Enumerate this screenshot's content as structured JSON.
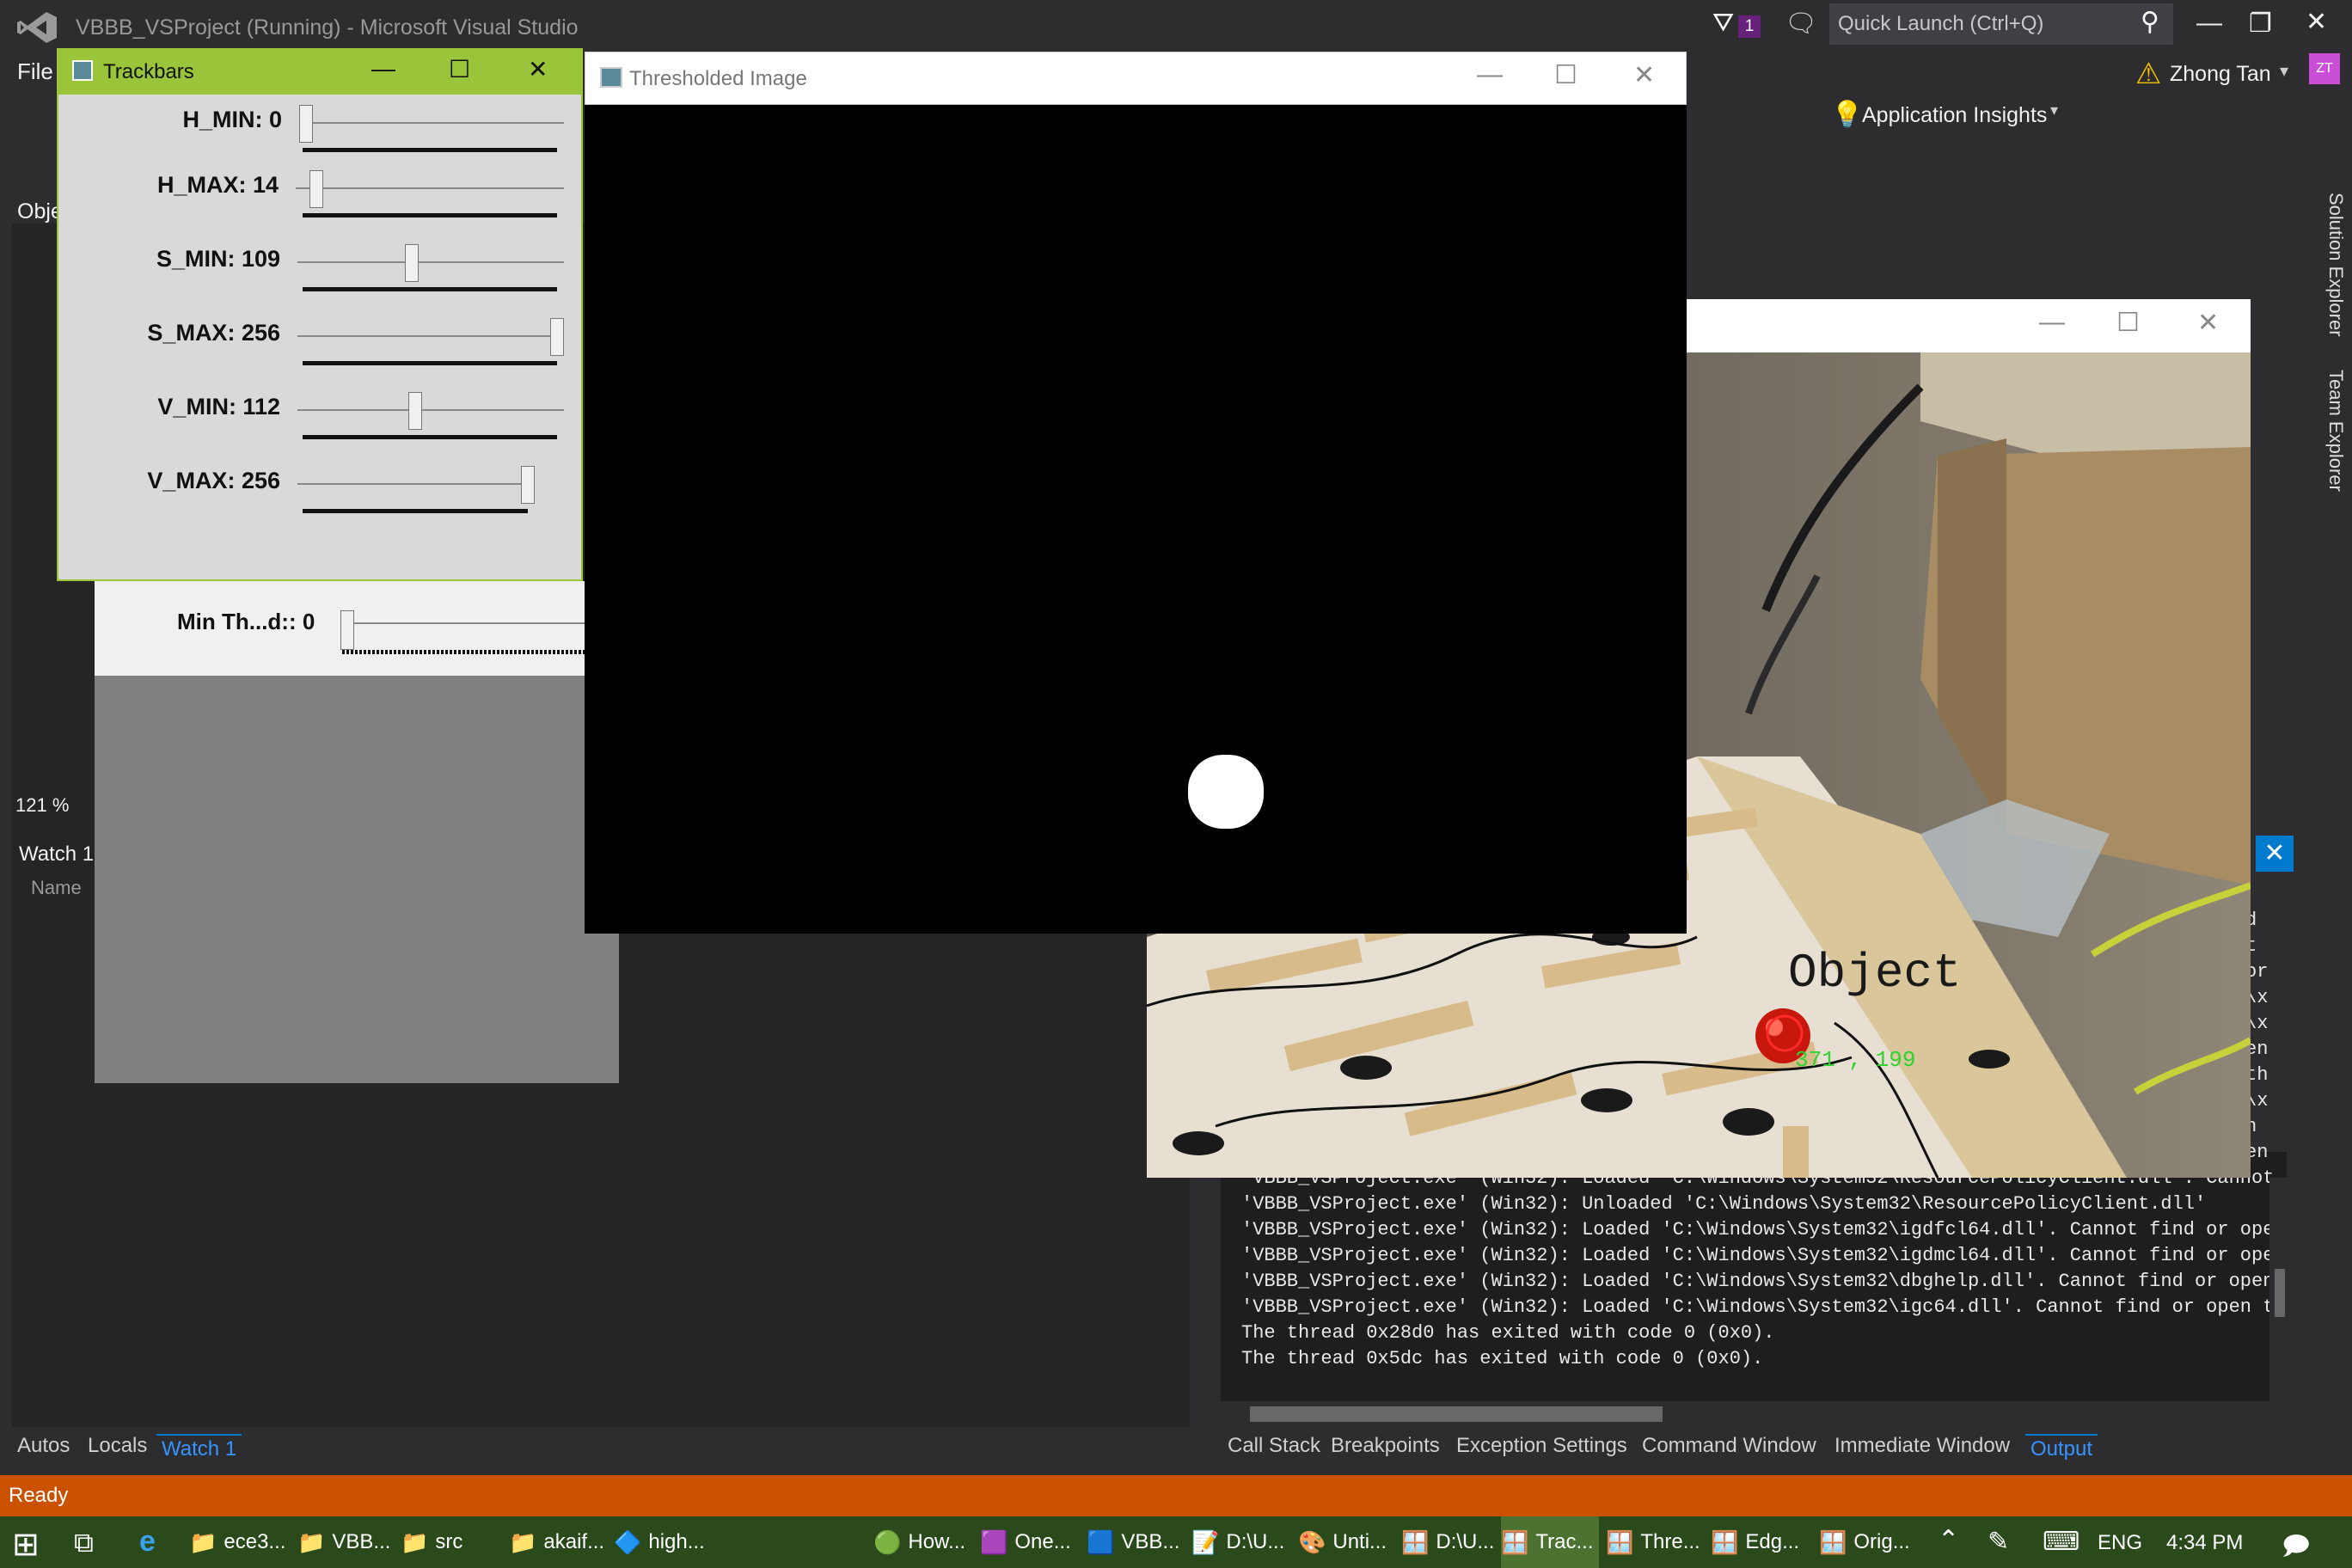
{
  "vs": {
    "title": "VBBB_VSProject (Running) - Microsoft Visual Studio",
    "menu_file": "File",
    "notif_count": "1",
    "quick_launch": "Quick Launch (Ctrl+Q)",
    "user_name": "Zhong Tan",
    "avatar": "ZT",
    "app_insights": "Application Insights",
    "obj_partial": "Obje",
    "zoom": "121 %",
    "watch_title": "Watch 1",
    "watch_name_col": "Name",
    "left_tabs": [
      "Autos",
      "Locals",
      "Watch 1"
    ],
    "right_tabs": [
      "Call Stack",
      "Breakpoints",
      "Exception Settings",
      "Command Window",
      "Immediate Window",
      "Output"
    ],
    "side_tabs": [
      "Solution Explorer",
      "Team Explorer"
    ],
    "status": "Ready",
    "accent_color": "#007acc",
    "status_color": "#ca5100"
  },
  "output": {
    "lines": [
      "'VBBB_VSProject.exe' (Win32): Loaded 'C:\\Windows\\System32\\ResourcePolicyClient.dll'. Cannot",
      "'VBBB_VSProject.exe' (Win32): Unloaded 'C:\\Windows\\System32\\ResourcePolicyClient.dll'",
      "'VBBB_VSProject.exe' (Win32): Loaded 'C:\\Windows\\System32\\igdfcl64.dll'. Cannot find or open",
      "'VBBB_VSProject.exe' (Win32): Loaded 'C:\\Windows\\System32\\igdmcl64.dll'. Cannot find or open",
      "'VBBB_VSProject.exe' (Win32): Loaded 'C:\\Windows\\System32\\dbghelp.dll'. Cannot find or open",
      "'VBBB_VSProject.exe' (Win32): Loaded 'C:\\Windows\\System32\\igc64.dll'. Cannot find or open th",
      "The thread 0x28d0 has exited with code 0 (0x0).",
      "The thread 0x5dc has exited with code 0 (0x0)."
    ],
    "cut_right": [
      "d",
      "t",
      "or",
      "\\x",
      "\\x",
      "en",
      "th",
      "\\x",
      "n",
      "en"
    ]
  },
  "trackbars": {
    "title": "Trackbars",
    "sliders": [
      {
        "label": "H_MIN: 0",
        "value": 0,
        "max": 256
      },
      {
        "label": "H_MAX: 14",
        "value": 14,
        "max": 256
      },
      {
        "label": "S_MIN: 109",
        "value": 109,
        "max": 256
      },
      {
        "label": "S_MAX: 256",
        "value": 256,
        "max": 256
      },
      {
        "label": "V_MIN: 112",
        "value": 112,
        "max": 256
      },
      {
        "label": "V_MAX: 256",
        "value": 256,
        "max": 256
      }
    ]
  },
  "edge": {
    "label": "Min Th...d:: 0"
  },
  "thresholded": {
    "title": "Thresholded Image"
  },
  "camera": {
    "object_label": "Object",
    "coords": "371 , 199"
  },
  "taskbar": {
    "items": [
      "ece3...",
      "VBB...",
      "src",
      "akaif...",
      "high...",
      "How...",
      "One...",
      "VBB...",
      "D:\\U...",
      "Unti...",
      "D:\\U...",
      "Trac...",
      "Thre...",
      "Edg...",
      "Orig..."
    ],
    "lang": "ENG",
    "clock": "4:34 PM",
    "bg_color": "#2b4a1c"
  }
}
